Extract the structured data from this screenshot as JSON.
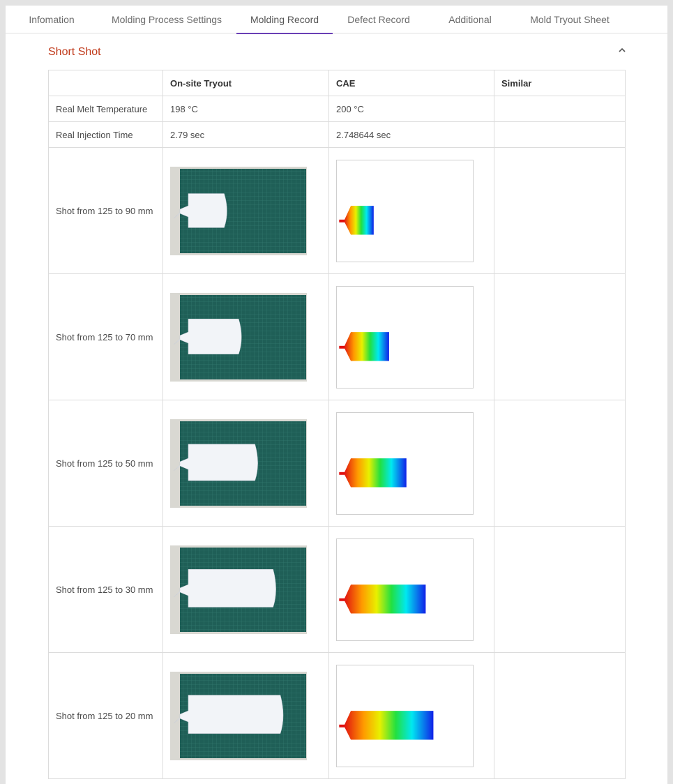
{
  "tabs": [
    {
      "label": "Infomation",
      "active": false
    },
    {
      "label": "Molding Process Settings",
      "active": false
    },
    {
      "label": "Molding Record",
      "active": true
    },
    {
      "label": "Defect Record",
      "active": false
    },
    {
      "label": "Additional",
      "active": false
    },
    {
      "label": "Mold Tryout Sheet",
      "active": false
    }
  ],
  "section": {
    "title": "Short Shot",
    "collapse_icon": "chevron-up-icon"
  },
  "table": {
    "headers": [
      "",
      "On-site Tryout",
      "CAE",
      "Similar"
    ],
    "text_rows": [
      {
        "label": "Real Melt Temperature",
        "onsite": "198 °C",
        "cae": "200 °C",
        "similar": ""
      },
      {
        "label": "Real Injection Time",
        "onsite": "2.79 sec",
        "cae": "2.748644 sec",
        "similar": ""
      }
    ],
    "image_rows": [
      {
        "label": "Shot from 125 to 90 mm",
        "fill": 0.18
      },
      {
        "label": "Shot from 125 to 70 mm",
        "fill": 0.34
      },
      {
        "label": "Shot from 125 to 50 mm",
        "fill": 0.52
      },
      {
        "label": "Shot from 125 to 30 mm",
        "fill": 0.72
      },
      {
        "label": "Shot from 125 to 20 mm",
        "fill": 0.8
      }
    ]
  },
  "colors": {
    "accent": "#6a3fb5",
    "section_title": "#c0391a",
    "mat_green": "#1f5f57"
  }
}
